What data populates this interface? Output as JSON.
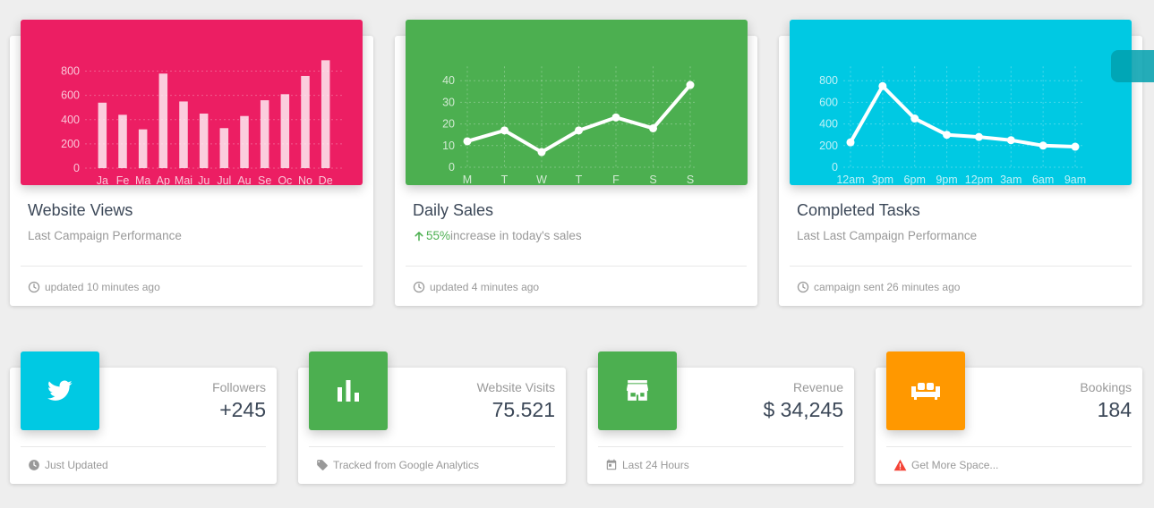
{
  "colors": {
    "pink": "#ec1e63",
    "green": "#4caf50",
    "cyan": "#00c9e3",
    "orange": "#ff9800",
    "accent_green": "#4caf50",
    "warning_red": "#f44336"
  },
  "cards": {
    "views": {
      "title": "Website Views",
      "subtitle": "Last Campaign Performance",
      "footer_icon": "clock-icon",
      "footer": "updated 10 minutes ago"
    },
    "sales": {
      "title": "Daily Sales",
      "subtitle_percent": "55%",
      "subtitle_rest": "increase in today's sales",
      "footer_icon": "clock-icon",
      "footer": "updated 4 minutes ago"
    },
    "tasks": {
      "title": "Completed Tasks",
      "subtitle": "Last Last Campaign Performance",
      "footer_icon": "clock-icon",
      "footer": "campaign sent 26 minutes ago"
    }
  },
  "stats": [
    {
      "icon": "twitter-icon",
      "category": "Followers",
      "value": "+245",
      "footer_icon": "clock-icon",
      "footer": "Just Updated"
    },
    {
      "icon": "bar-chart-icon",
      "category": "Website Visits",
      "value": "75.521",
      "footer_icon": "tag-icon",
      "footer": "Tracked from Google Analytics"
    },
    {
      "icon": "store-icon",
      "category": "Revenue",
      "value": "$ 34,245",
      "footer_icon": "calendar-icon",
      "footer": "Last 24 Hours"
    },
    {
      "icon": "sofa-icon",
      "category": "Bookings",
      "value": "184",
      "footer_icon": "warning-icon",
      "footer": "Get More Space..."
    }
  ],
  "chart_data": [
    {
      "type": "bar",
      "categories": [
        "Ja",
        "Fe",
        "Ma",
        "Ap",
        "Mai",
        "Ju",
        "Jul",
        "Au",
        "Se",
        "Oc",
        "No",
        "De"
      ],
      "values": [
        540,
        440,
        320,
        780,
        550,
        450,
        330,
        430,
        560,
        610,
        760,
        890
      ],
      "ylim": [
        0,
        900
      ],
      "yticks": [
        0,
        200,
        400,
        600,
        800
      ],
      "grid": true
    },
    {
      "type": "line",
      "categories": [
        "M",
        "T",
        "W",
        "T",
        "F",
        "S",
        "S"
      ],
      "values": [
        12,
        17,
        7,
        17,
        23,
        18,
        38
      ],
      "ylim": [
        0,
        50
      ],
      "yticks": [
        0,
        10,
        20,
        30,
        40
      ],
      "grid": true
    },
    {
      "type": "line",
      "categories": [
        "12am",
        "3pm",
        "6pm",
        "9pm",
        "12pm",
        "3am",
        "6am",
        "9am"
      ],
      "values": [
        230,
        750,
        450,
        300,
        280,
        250,
        200,
        190
      ],
      "ylim": [
        0,
        1000
      ],
      "yticks": [
        0,
        200,
        400,
        600,
        800
      ],
      "grid": true
    }
  ]
}
